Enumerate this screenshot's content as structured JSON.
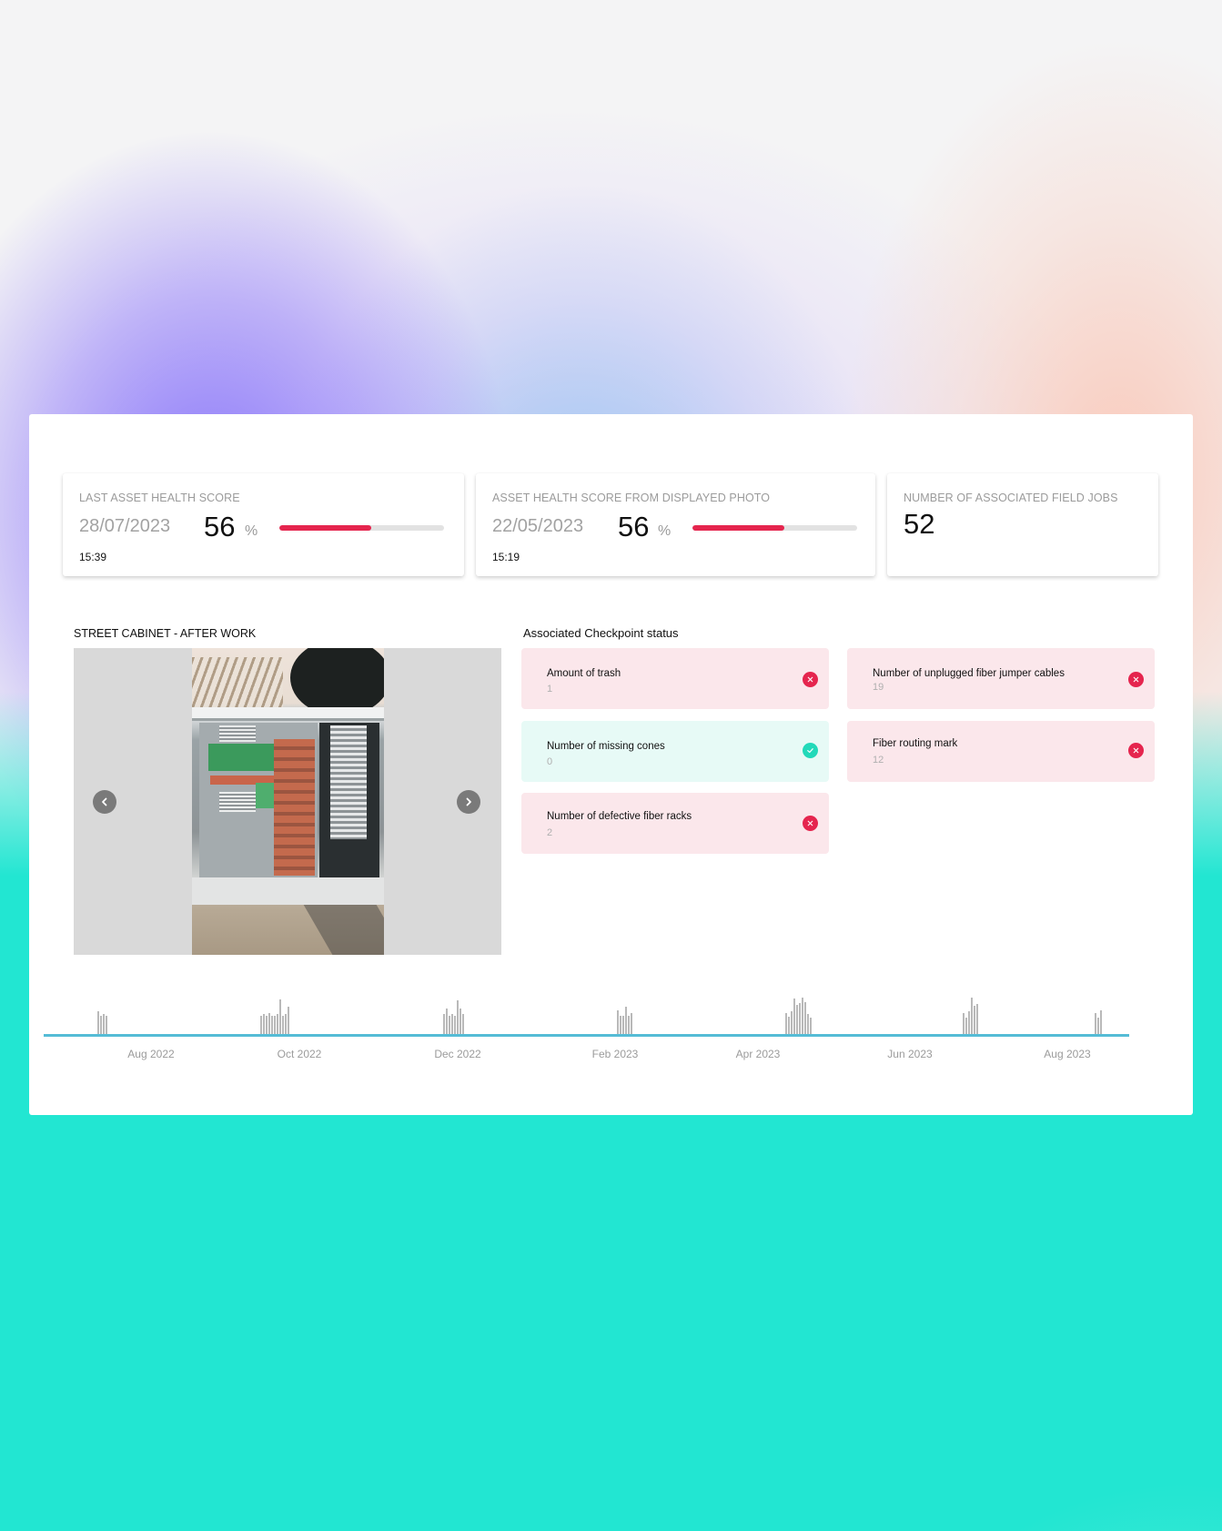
{
  "stats": [
    {
      "title": "LAST ASSET HEALTH SCORE",
      "date": "28/07/2023",
      "time": "15:39",
      "score": "56",
      "unit": "%",
      "progress_percent": 56
    },
    {
      "title": "ASSET HEALTH SCORE FROM DISPLAYED PHOTO",
      "date": "22/05/2023",
      "time": "15:19",
      "score": "56",
      "unit": "%",
      "progress_percent": 56
    },
    {
      "title": "NUMBER OF ASSOCIATED FIELD JOBS",
      "value": "52"
    }
  ],
  "photo_section": {
    "title": "STREET CABINET - AFTER WORK",
    "prev_icon": "chevron-left-icon",
    "next_icon": "chevron-right-icon"
  },
  "checkpoints": {
    "title": "Associated Checkpoint status",
    "items": [
      {
        "label": "Amount of trash",
        "value": "1",
        "status": "fail",
        "icon": "x-circle-icon"
      },
      {
        "label": "Number of missing cones",
        "value": "0",
        "status": "pass",
        "icon": "check-circle-icon"
      },
      {
        "label": "Number of defective fiber racks",
        "value": "2",
        "status": "fail",
        "icon": "x-circle-icon"
      },
      {
        "label": "Number of unplugged fiber jumper cables",
        "value": "19",
        "status": "fail",
        "icon": "x-circle-icon"
      },
      {
        "label": "Fiber routing mark",
        "value": "12",
        "status": "fail",
        "icon": "x-circle-icon"
      }
    ]
  },
  "colors": {
    "fail": "#e5254e",
    "pass": "#22d9b9",
    "axis": "#55bcd6",
    "progress_track": "#e2e2e2"
  },
  "timeline": {
    "labels": [
      "Aug 2022",
      "Oct 2022",
      "Dec 2022",
      "Feb 2023",
      "Apr 2023",
      "Jun 2023",
      "Aug 2023"
    ],
    "clusters": [
      {
        "near": "Aug 2022",
        "bars": [
          0.62,
          0.5,
          0.55,
          0.5
        ]
      },
      {
        "near": "Oct 2022",
        "bars": [
          0.5,
          0.55,
          0.5,
          0.58,
          0.5,
          0.5,
          0.55,
          0.95,
          0.5,
          0.55,
          0.75
        ]
      },
      {
        "near": "Dec 2022",
        "bars": [
          0.55,
          0.7,
          0.5,
          0.55,
          0.5,
          0.92,
          0.7,
          0.55
        ]
      },
      {
        "near": "Feb 2023",
        "bars": [
          0.65,
          0.5,
          0.5,
          0.75,
          0.5,
          0.58
        ]
      },
      {
        "near": "Apr 2023",
        "bars": [
          0.58,
          0.48,
          0.62,
          0.98,
          0.8,
          0.85,
          1.0,
          0.88,
          0.55,
          0.45
        ]
      },
      {
        "near": "Jun 2023",
        "bars": [
          0.58,
          0.45,
          0.62,
          1.0,
          0.78,
          0.82
        ]
      },
      {
        "near": "Aug 2023",
        "bars": [
          0.58,
          0.45,
          0.65
        ]
      }
    ]
  }
}
